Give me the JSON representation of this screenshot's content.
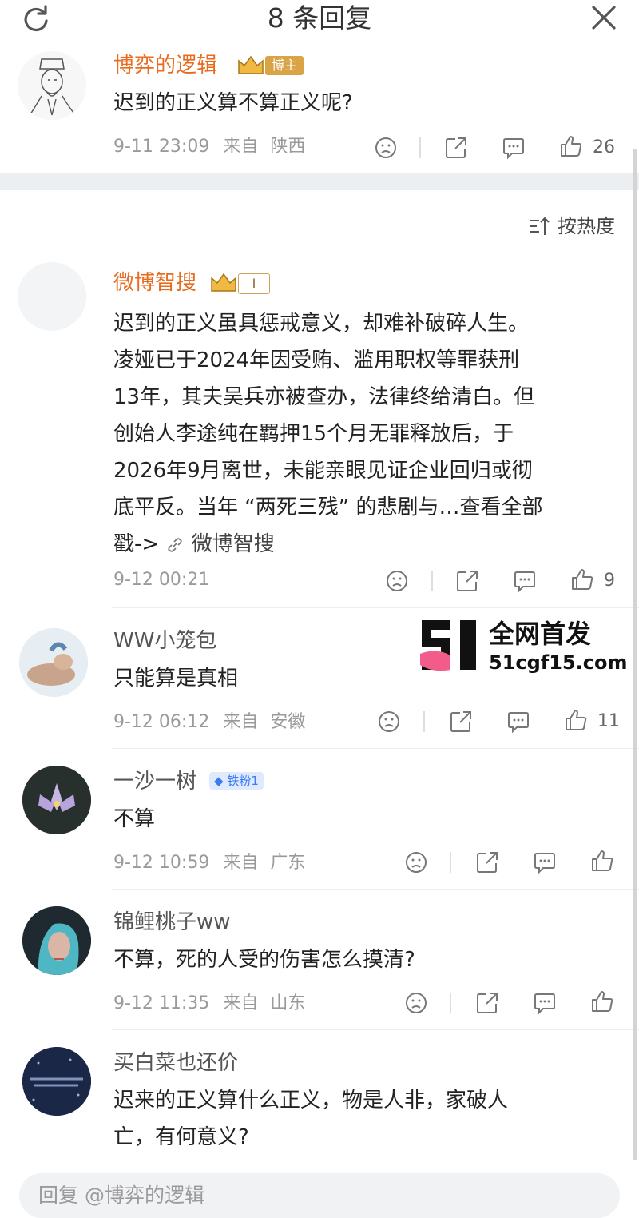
{
  "header": {
    "title": "8 条回复",
    "refresh_icon": "refresh-icon",
    "close_icon": "close-icon"
  },
  "post": {
    "author": "博弈的逻辑",
    "badge": "博主",
    "text": "迟到的正义算不算正义呢?",
    "time": "9-11 23:09",
    "from_label": "来自",
    "location": "陕西",
    "likes": "26"
  },
  "sort": {
    "label": "按热度"
  },
  "comments": [
    {
      "author": "微博智搜",
      "badge": "I",
      "text": "迟到的正义虽具惩戒意义，却难补破碎人生。凌娅已于2024年因受贿、滥用职权等罪获刑13年，其夫吴兵亦被查办，法律终给清白。但创始人李途纯在羁押15个月无罪释放后，于2026年9月离世，未能亲眼见证企业回归或彻底平反。当年 “两死三残” 的悲剧与…查看全部",
      "line1": "迟到的正义虽具惩戒意义，却难补破碎人生。",
      "line2": "凌娅已于2024年因受贿、滥用职权等罪获刑",
      "line3": "13年，其夫吴兵亦被查办，法律终给清白。但",
      "line4": "创始人李途纯在羁押15个月无罪释放后，于",
      "line5": "2026年9月离世，未能亲眼见证企业回归或彻",
      "line6": "底平反。当年 “两死三残” 的悲剧与…查看全部",
      "line7_prefix": "戳->",
      "link_text": "微博智搜",
      "time": "9-12 00:21",
      "likes": "9"
    },
    {
      "author": "WW小笼包",
      "text": "只能算是真相",
      "time": "9-12 06:12",
      "from_label": "来自",
      "location": "安徽",
      "likes": "11"
    },
    {
      "author": "一沙一树",
      "badge": "铁粉1",
      "text": "不算",
      "time": "9-12 10:59",
      "from_label": "来自",
      "location": "广东"
    },
    {
      "author": "锦鲤桃子ww",
      "text": "不算，死的人受的伤害怎么摸清?",
      "time": "9-12 11:35",
      "from_label": "来自",
      "location": "山东"
    },
    {
      "author": "买白菜也还价",
      "line1": "迟来的正义算什么正义，物是人非，家破人",
      "line2": "亡，有何意义?"
    }
  ],
  "watermark": {
    "line1": "全网首发",
    "line2": "51cgf15.com"
  },
  "reply_bar": {
    "placeholder": "回复 @博弈的逻辑"
  },
  "colors": {
    "author_highlight": "#e86b1e",
    "meta": "#9a9a9a",
    "fan_badge": "#3a7bf3"
  }
}
